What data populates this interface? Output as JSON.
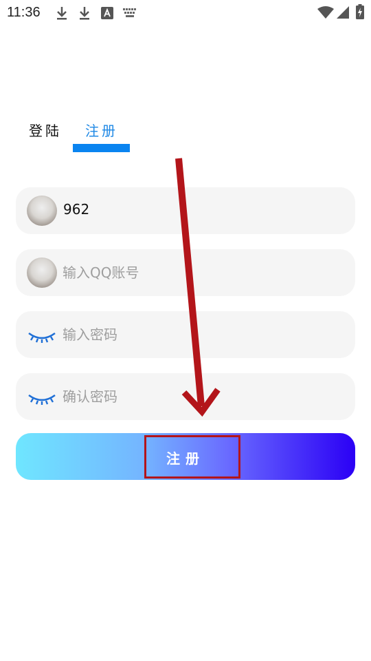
{
  "status_bar": {
    "time": "11:36",
    "icons": [
      "download-icon",
      "download-icon",
      "font-icon",
      "keyboard-icon",
      "wifi-icon",
      "signal-icon",
      "battery-charging-icon"
    ]
  },
  "tabs": [
    {
      "label": "登陆",
      "active": false
    },
    {
      "label": "注册",
      "active": true
    }
  ],
  "form": {
    "username_value": "962",
    "qq_placeholder": "输入QQ账号",
    "password_placeholder": "输入密码",
    "confirm_placeholder": "确认密码",
    "submit_label": "注册"
  },
  "colors": {
    "accent": "#0a84f0",
    "annotation": "#b3151a"
  }
}
